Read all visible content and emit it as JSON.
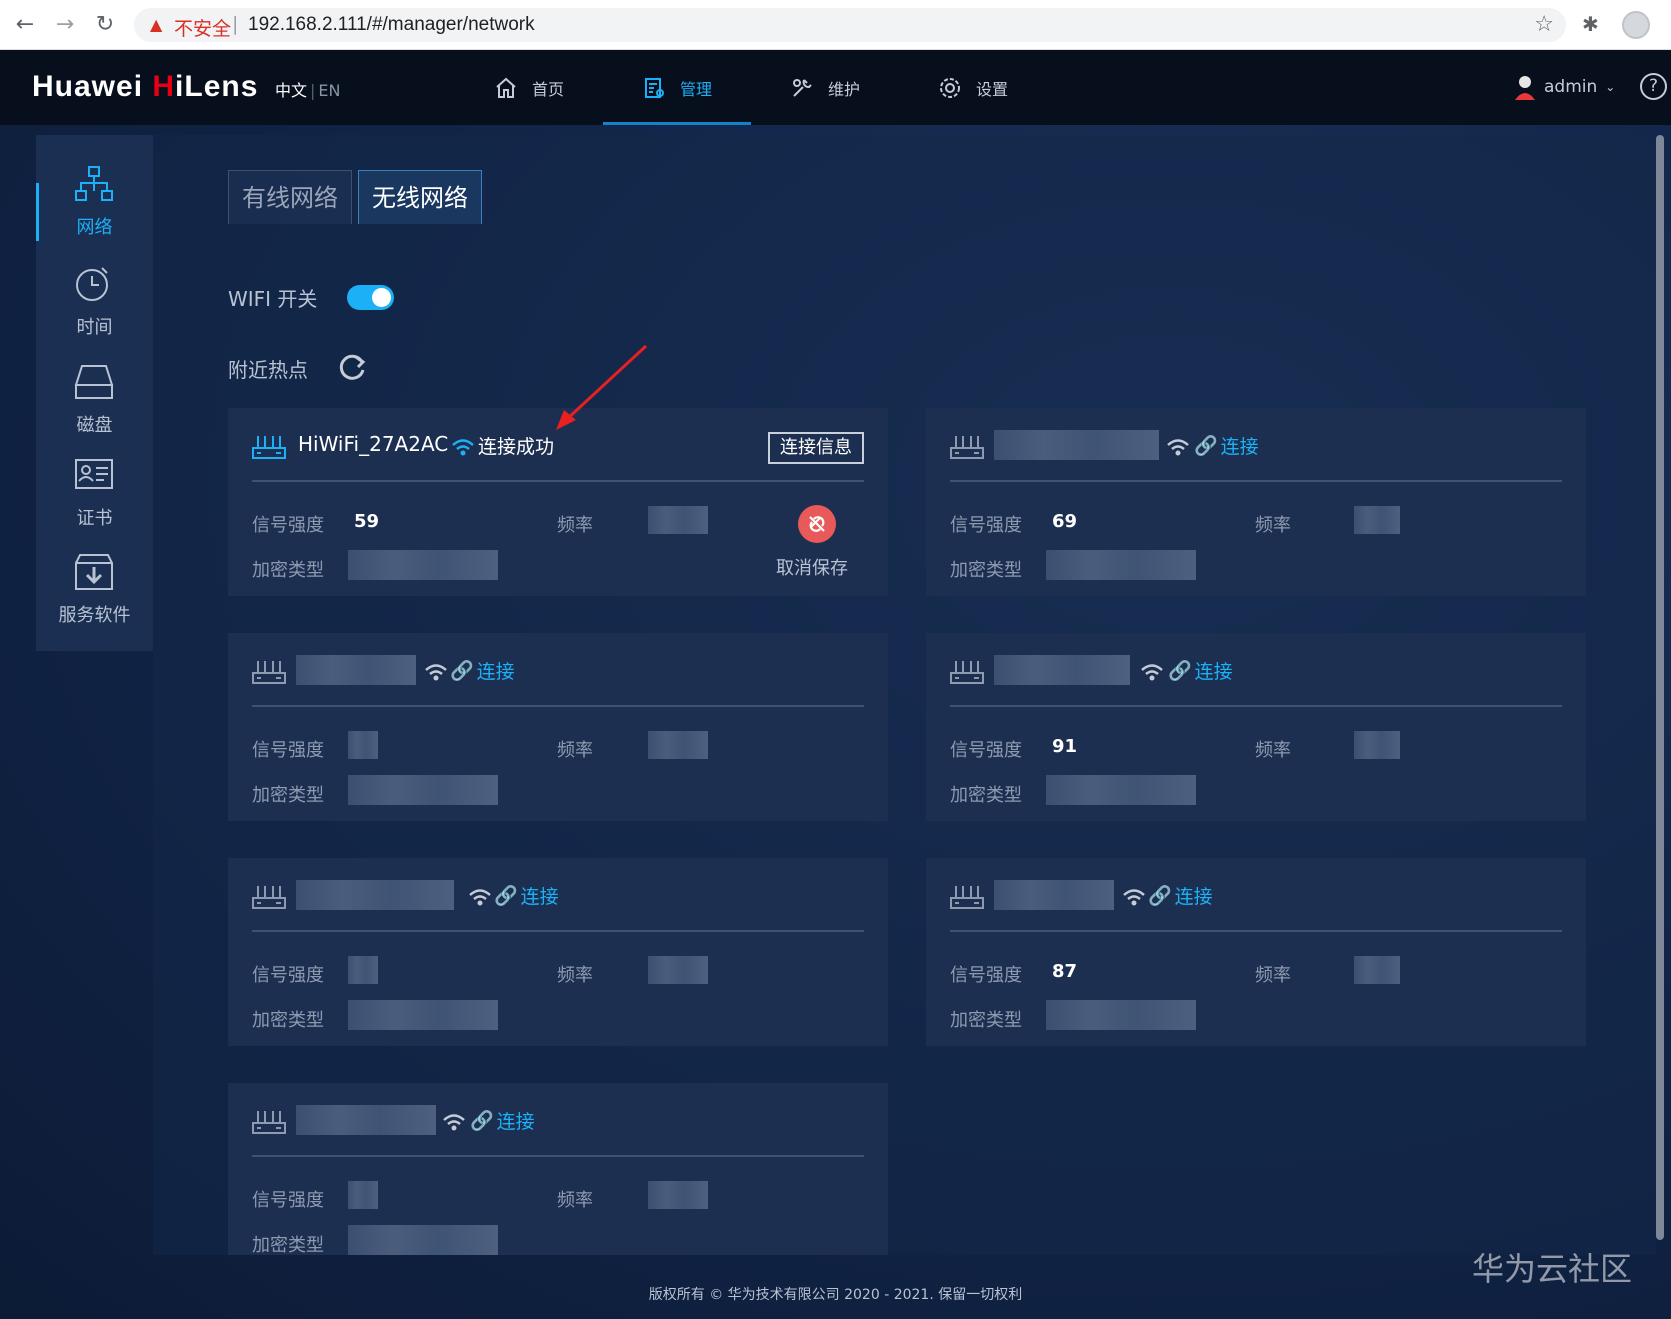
{
  "browser": {
    "insecure_label": "不安全",
    "separator": "|",
    "url": "192.168.2.111/#/manager/network"
  },
  "header": {
    "logo_prefix": "Huawei ",
    "logo_h": "H",
    "logo_rest": "iLens",
    "lang_zh": "中文",
    "lang_sep": "|",
    "lang_en": "EN",
    "nav": [
      {
        "label": "首页",
        "icon": "home-icon"
      },
      {
        "label": "管理",
        "icon": "manage-icon"
      },
      {
        "label": "维护",
        "icon": "maintenance-icon"
      },
      {
        "label": "设置",
        "icon": "settings-icon"
      }
    ],
    "active_nav": 1,
    "user": "admin",
    "help": "?"
  },
  "sidebar": {
    "items": [
      {
        "label": "网络",
        "icon": "network-icon"
      },
      {
        "label": "时间",
        "icon": "clock-icon"
      },
      {
        "label": "磁盘",
        "icon": "disk-icon"
      },
      {
        "label": "证书",
        "icon": "certificate-icon"
      },
      {
        "label": "服务软件",
        "icon": "download-icon"
      }
    ],
    "active": 0
  },
  "tabs": {
    "wired": "有线网络",
    "wireless": "无线网络",
    "active": "wireless"
  },
  "wifi": {
    "switch_label": "WIFI 开关",
    "switch_on": true,
    "nearby_label": "附近热点"
  },
  "labels": {
    "signal": "信号强度",
    "freq": "频率",
    "encrypt": "加密类型",
    "connect": "连接",
    "connected": "连接成功",
    "connection_info": "连接信息",
    "unsave": "取消保存"
  },
  "hotspots": [
    {
      "ssid": "HiWiFi_27A2AC",
      "connected": true,
      "signal": "59"
    },
    {
      "ssid": "",
      "connected": false,
      "signal": "69"
    },
    {
      "ssid": "",
      "connected": false,
      "signal": ""
    },
    {
      "ssid": "",
      "connected": false,
      "signal": "91"
    },
    {
      "ssid": "",
      "connected": false,
      "signal": ""
    },
    {
      "ssid": "",
      "connected": false,
      "signal": "87"
    },
    {
      "ssid": "",
      "connected": false,
      "signal": ""
    }
  ],
  "footer": "版权所有 © 华为技术有限公司 2020 - 2021. 保留一切权利",
  "watermark": "华为云社区",
  "colors": {
    "accent": "#1cb0f6",
    "brand_red": "#e60012",
    "danger": "#e85a5a",
    "card_bg": "#1c2f50"
  }
}
